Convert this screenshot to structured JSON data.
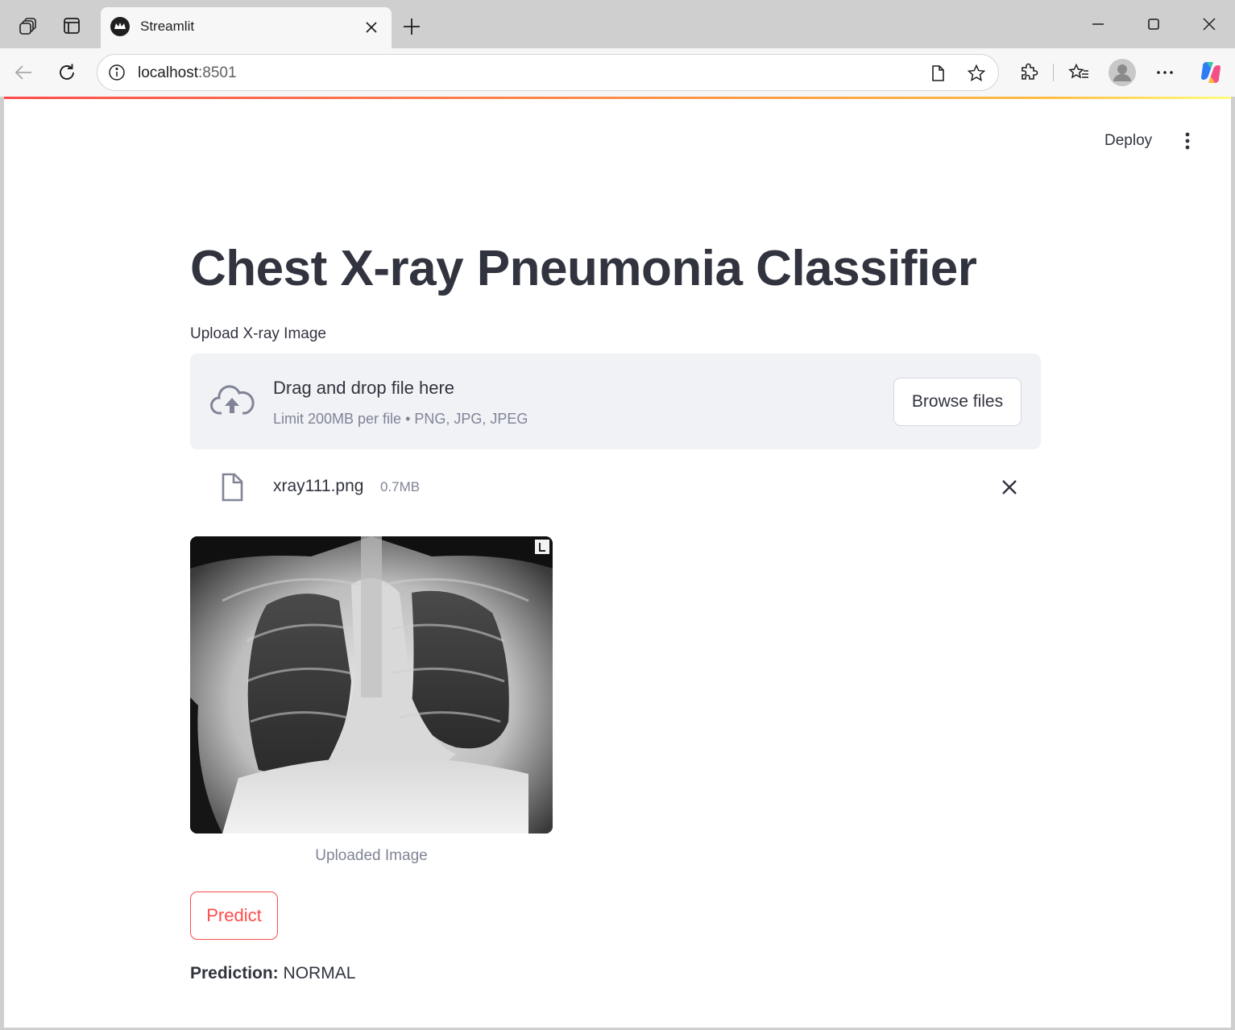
{
  "browser": {
    "tab_title": "Streamlit",
    "url_host": "localhost",
    "url_port": ":8501"
  },
  "header": {
    "deploy_label": "Deploy"
  },
  "main": {
    "title": "Chest X-ray Pneumonia Classifier",
    "uploader": {
      "label": "Upload X-ray Image",
      "drop_text": "Drag and drop file here",
      "limit_text": "Limit 200MB per file • PNG, JPG, JPEG",
      "browse_label": "Browse files"
    },
    "uploaded_file": {
      "name": "xray111.png",
      "size": "0.7MB"
    },
    "image_caption": "Uploaded Image",
    "predict_label": "Predict",
    "prediction": {
      "label": "Prediction:",
      "value": "NORMAL"
    }
  },
  "colors": {
    "primary": "#ff4b4b",
    "text": "#31333f",
    "muted": "#808495",
    "dropzone_bg": "#f0f2f6"
  }
}
